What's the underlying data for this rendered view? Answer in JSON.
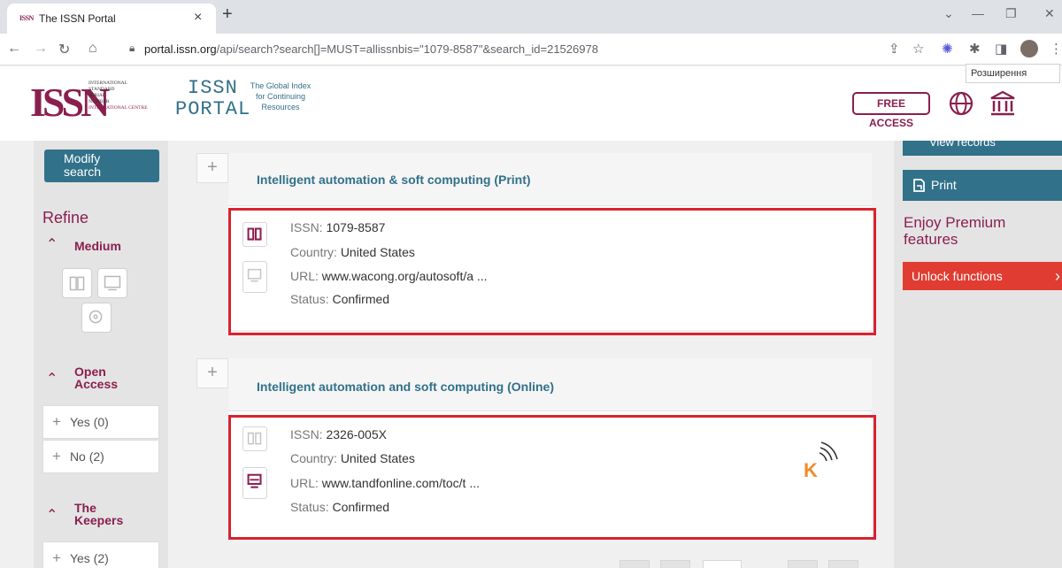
{
  "browser": {
    "tab_favicon": "ISSN",
    "tab_title": "The ISSN Portal",
    "tab_close": "×",
    "new_tab": "+",
    "url_host": "portal.issn.org",
    "url_path": "/api/search?search[]=MUST=allissnbis=\"1079-8587\"&search_id=21526978",
    "tooltip": "Розширення"
  },
  "header": {
    "issn_logo": "ISSN",
    "issn_sub_lines": [
      "INTERNATIONAL",
      "STANDARD",
      "SERIAL",
      "NUMBER",
      "INTERNATIONAL CENTRE"
    ],
    "portal_line1": "ISSN",
    "portal_line2": "PORTAL",
    "tagline_lines": [
      "The Global Index",
      "for Continuing",
      "Resources"
    ],
    "free_access": "FREE ACCESS"
  },
  "sidebar": {
    "modify_line1": "Modify",
    "modify_line2": "search",
    "refine": "Refine",
    "facets": [
      {
        "title_line1": "Medium",
        "title_line2": ""
      },
      {
        "title_line1": "Open",
        "title_line2": "Access",
        "items": [
          "Yes (0)",
          "No (2)"
        ]
      },
      {
        "title_line1": "The",
        "title_line2": "Keepers",
        "items": [
          "Yes (2)"
        ]
      }
    ]
  },
  "results": [
    {
      "title": "Intelligent automation & soft computing (Print)",
      "issn_label": "ISSN:",
      "issn": "1079-8587",
      "country_label": "Country:",
      "country": "United States",
      "url_label": "URL:",
      "url": "www.wacong.org/autosoft/a ...",
      "status_label": "Status:",
      "status": "Confirmed",
      "medium": "print"
    },
    {
      "title": "Intelligent automation and soft computing (Online)",
      "issn_label": "ISSN:",
      "issn": "2326-005X",
      "country_label": "Country:",
      "country": "United States",
      "url_label": "URL:",
      "url": "www.tandfonline.com/toc/t ...",
      "status_label": "Status:",
      "status": "Confirmed",
      "medium": "online"
    }
  ],
  "right_rail": {
    "view_records": "View records",
    "print": "Print",
    "premium_line1": "Enjoy Premium",
    "premium_line2": "features",
    "unlock": "Unlock functions"
  },
  "colors": {
    "brand": "#8a1f4e",
    "accent": "#31718a",
    "highlight": "#d9232e",
    "unlock": "#e03c31"
  }
}
